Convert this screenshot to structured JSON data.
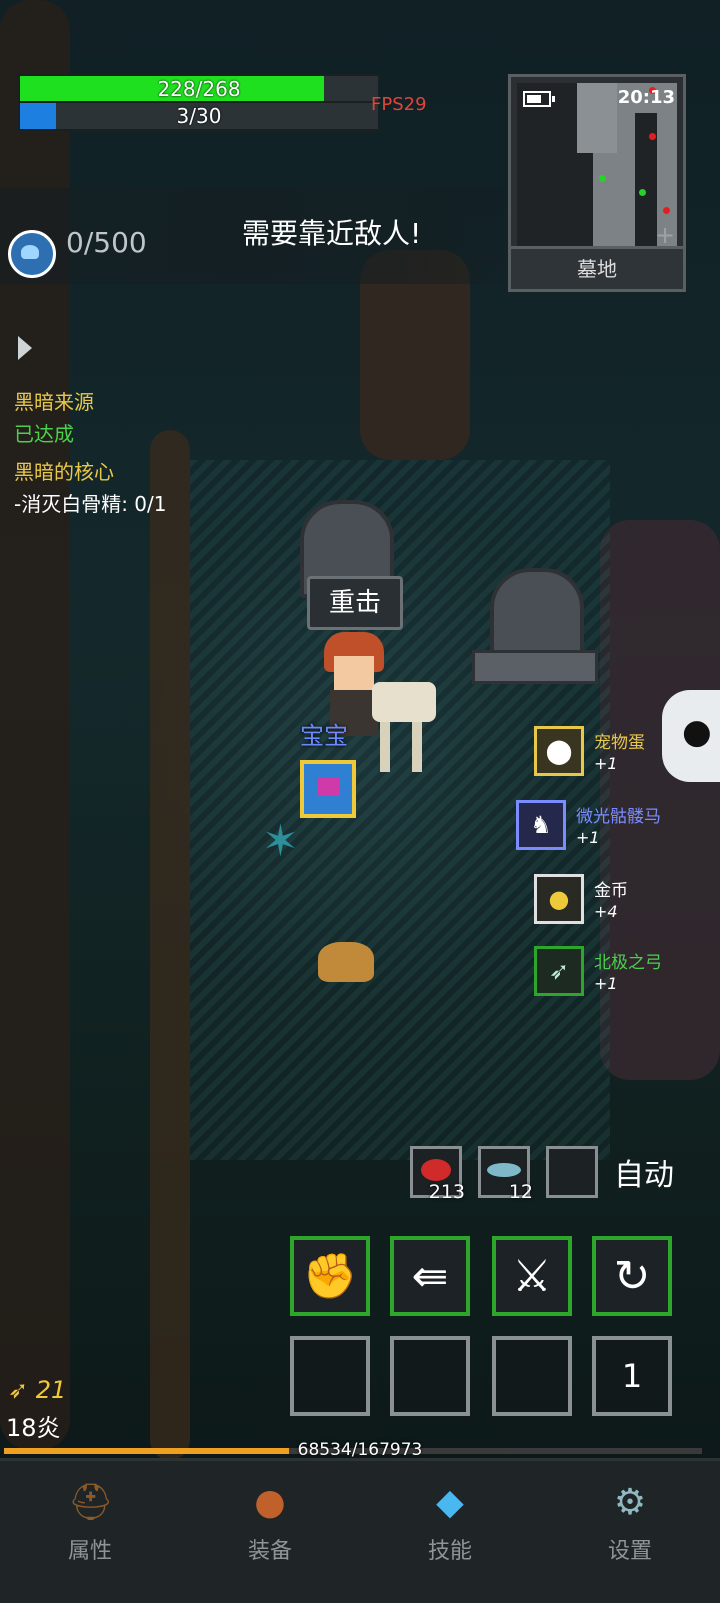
{
  "hud": {
    "hp_text": "228/268",
    "hp_fraction": 0.85,
    "mp_text": "3/30",
    "mp_fraction": 0.1,
    "fps": "FPS29"
  },
  "minimap": {
    "time": "20:13",
    "zone": "墓地"
  },
  "notice": {
    "energy": "0/500",
    "message": "需要靠近敌人!"
  },
  "quests": [
    {
      "text": "黑暗来源",
      "color": "#e8c84a"
    },
    {
      "text": "已达成",
      "color": "#4bd04b"
    },
    {
      "text": "黑暗的核心",
      "color": "#e8c84a"
    },
    {
      "text": "-消灭白骨精: 0/1",
      "color": "#ffffff"
    }
  ],
  "scene": {
    "skill_popup": "重击",
    "pet_name": "宝宝"
  },
  "loot": [
    {
      "name": "宠物蛋",
      "count": "+1",
      "color": "#e8c84a",
      "icon": "egg-icon"
    },
    {
      "name": "微光骷髅马",
      "count": "+1",
      "color": "#7b8cff",
      "icon": "skeleton-horse-icon"
    },
    {
      "name": "金币",
      "count": "+4",
      "color": "#ffffff",
      "icon": "gold-coin-icon"
    },
    {
      "name": "北极之弓",
      "count": "+1",
      "color": "#4bd04b",
      "icon": "bow-icon"
    }
  ],
  "consumables": [
    {
      "icon": "meat-icon",
      "count": "213"
    },
    {
      "icon": "fish-icon",
      "count": "12"
    },
    {
      "icon": "empty-slot",
      "count": ""
    }
  ],
  "auto_label": "自动",
  "skills": [
    "fist-icon",
    "dash-icon",
    "crossed-swords-icon",
    "whirl-icon"
  ],
  "extra_slot_number": "1",
  "player": {
    "level": "21",
    "name": "18炎",
    "xp_text": "68534/167973",
    "xp_fraction": 0.408
  },
  "nav": [
    {
      "label": "属性",
      "icon": "helmet-icon"
    },
    {
      "label": "装备",
      "icon": "bag-icon"
    },
    {
      "label": "技能",
      "icon": "crystal-icon"
    },
    {
      "label": "设置",
      "icon": "gear-icon"
    }
  ]
}
